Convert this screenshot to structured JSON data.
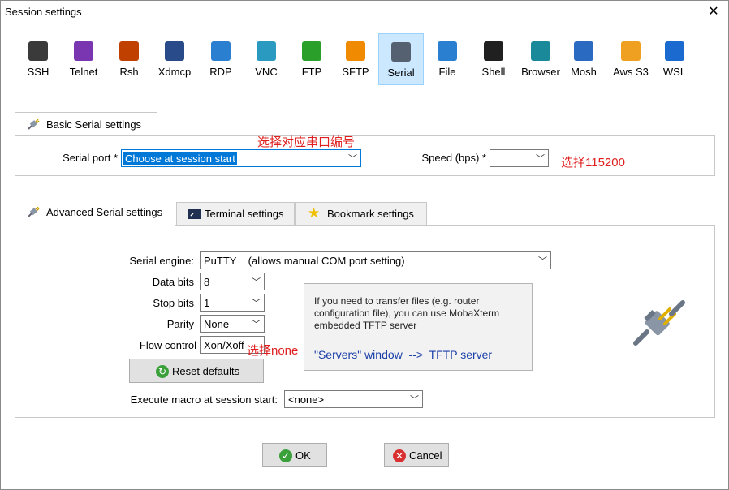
{
  "window": {
    "title": "Session settings"
  },
  "session_types": [
    {
      "label": "SSH",
      "icon": "key-icon",
      "color": "#3a3a3a"
    },
    {
      "label": "Telnet",
      "icon": "telnet-icon",
      "color": "#7a35b0"
    },
    {
      "label": "Rsh",
      "icon": "rsh-icon",
      "color": "#c04000"
    },
    {
      "label": "Xdmcp",
      "icon": "xdmcp-icon",
      "color": "#2a4b8a"
    },
    {
      "label": "RDP",
      "icon": "rdp-icon",
      "color": "#2a7fd0"
    },
    {
      "label": "VNC",
      "icon": "vnc-icon",
      "color": "#2a9ac0"
    },
    {
      "label": "FTP",
      "icon": "ftp-icon",
      "color": "#2aa02a"
    },
    {
      "label": "SFTP",
      "icon": "sftp-icon",
      "color": "#f08a00"
    },
    {
      "label": "Serial",
      "icon": "serial-plug-icon",
      "color": "#556070"
    },
    {
      "label": "File",
      "icon": "file-icon",
      "color": "#2a7fd0"
    },
    {
      "label": "Shell",
      "icon": "shell-icon",
      "color": "#202020"
    },
    {
      "label": "Browser",
      "icon": "browser-globe-icon",
      "color": "#1a8a9a"
    },
    {
      "label": "Mosh",
      "icon": "mosh-antenna-icon",
      "color": "#2a6ac0"
    },
    {
      "label": "Aws S3",
      "icon": "aws-s3-icon",
      "color": "#f0a020"
    },
    {
      "label": "WSL",
      "icon": "wsl-windows-icon",
      "color": "#1a6ad0"
    }
  ],
  "basic": {
    "tab_label": "Basic Serial settings",
    "serial_port_label": "Serial port *",
    "serial_port_value": "Choose at session start",
    "speed_label": "Speed (bps) *",
    "speed_value": "",
    "note_port": "选择对应串口编号",
    "note_speed": "选择115200"
  },
  "advanced_tabs": [
    {
      "label": "Advanced Serial settings",
      "icon": "plug-icon"
    },
    {
      "label": "Terminal settings",
      "icon": "terminal-icon"
    },
    {
      "label": "Bookmark settings",
      "icon": "star-icon"
    }
  ],
  "advanced": {
    "engine_label": "Serial engine:",
    "engine_value": "PuTTY    (allows manual COM port setting)",
    "data_bits_label": "Data bits",
    "data_bits_value": "8",
    "stop_bits_label": "Stop bits",
    "stop_bits_value": "1",
    "parity_label": "Parity",
    "parity_value": "None",
    "flow_label": "Flow control",
    "flow_value": "Xon/Xoff",
    "note_flow": "选择none",
    "reset_label": "Reset defaults",
    "macro_label": "Execute macro at session start:",
    "macro_value": "<none>",
    "info_text": "If you need to transfer files (e.g. router configuration file), you can use MobaXterm embedded TFTP server",
    "info_link": "\"Servers\" window  -->  TFTP server"
  },
  "buttons": {
    "ok": "OK",
    "cancel": "Cancel"
  },
  "colors": {
    "selection": "#0078d7",
    "annotation": "#e02020",
    "selected_tile": "#cce8ff"
  }
}
